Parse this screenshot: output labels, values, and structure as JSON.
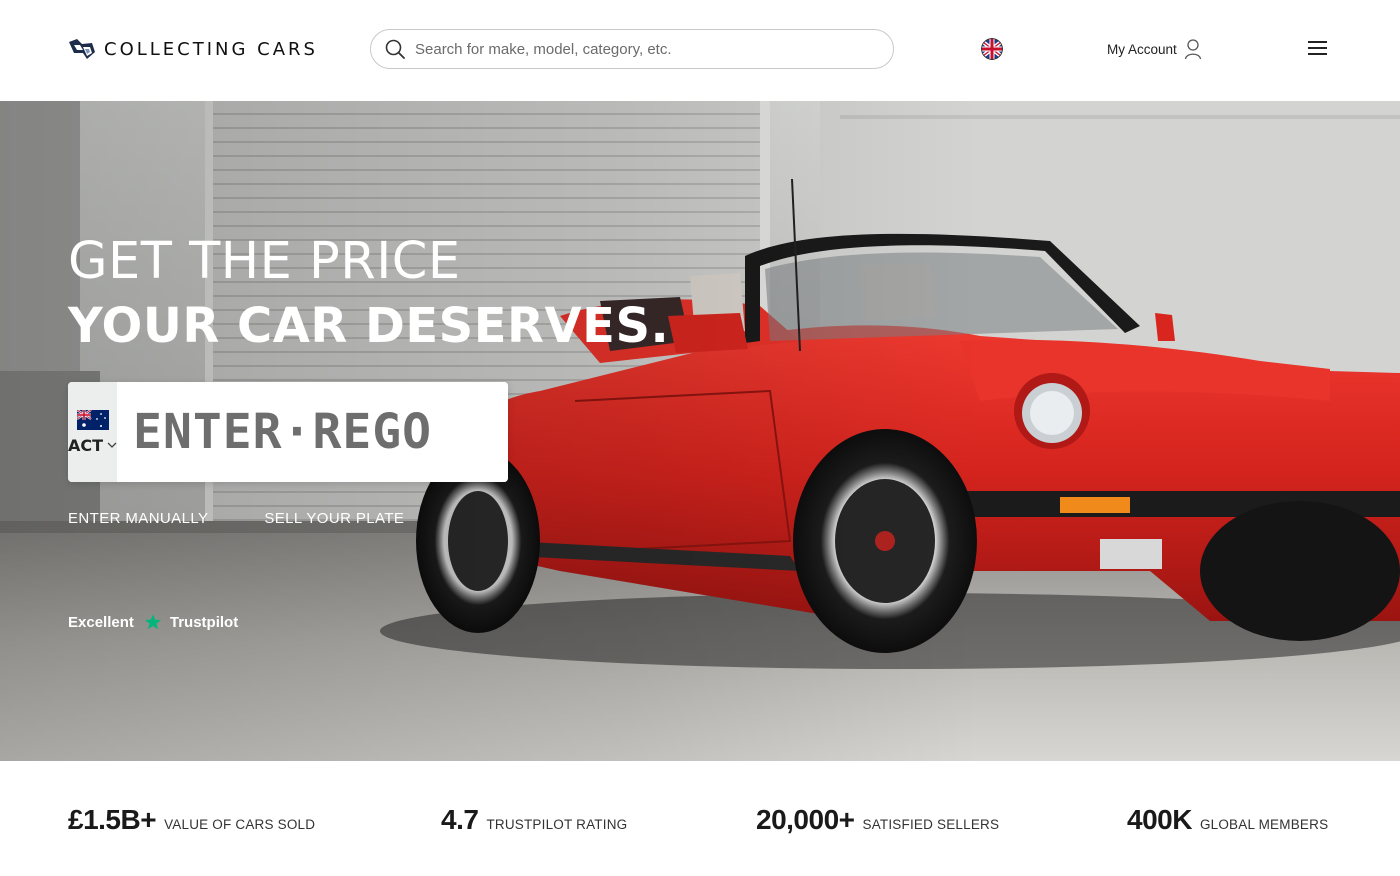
{
  "brand": {
    "name": "COLLECTING CARS"
  },
  "search": {
    "placeholder": "Search for make, model, category, etc."
  },
  "header": {
    "account_label": "My Account"
  },
  "hero": {
    "title_line1": "GET THE PRICE",
    "title_line2": "YOUR CAR DESERVES.",
    "plate": {
      "state": "ACT",
      "placeholder": "ENTER·REGO"
    },
    "links": [
      "ENTER MANUALLY",
      "SELL YOUR PLATE"
    ],
    "trust": {
      "rating_word": "Excellent",
      "brand": "Trustpilot"
    }
  },
  "stats": [
    {
      "value": "£1.5B+",
      "label": "VALUE OF CARS SOLD"
    },
    {
      "value": "4.7",
      "label": "TRUSTPILOT RATING"
    },
    {
      "value": "20,000+",
      "label": "SATISFIED SELLERS"
    },
    {
      "value": "400K",
      "label": "GLOBAL MEMBERS"
    }
  ],
  "icons": {
    "search": "search-icon",
    "language_flag": "uk-flag-icon",
    "account": "user-icon",
    "menu": "hamburger-menu-icon",
    "plate_flag": "australia-flag-icon",
    "state_dropdown": "chevron-down-icon",
    "trustpilot": "star-icon"
  },
  "colors": {
    "trustpilot_green": "#00b67a",
    "car_red": "#d8261f",
    "text_dark": "#111111"
  }
}
